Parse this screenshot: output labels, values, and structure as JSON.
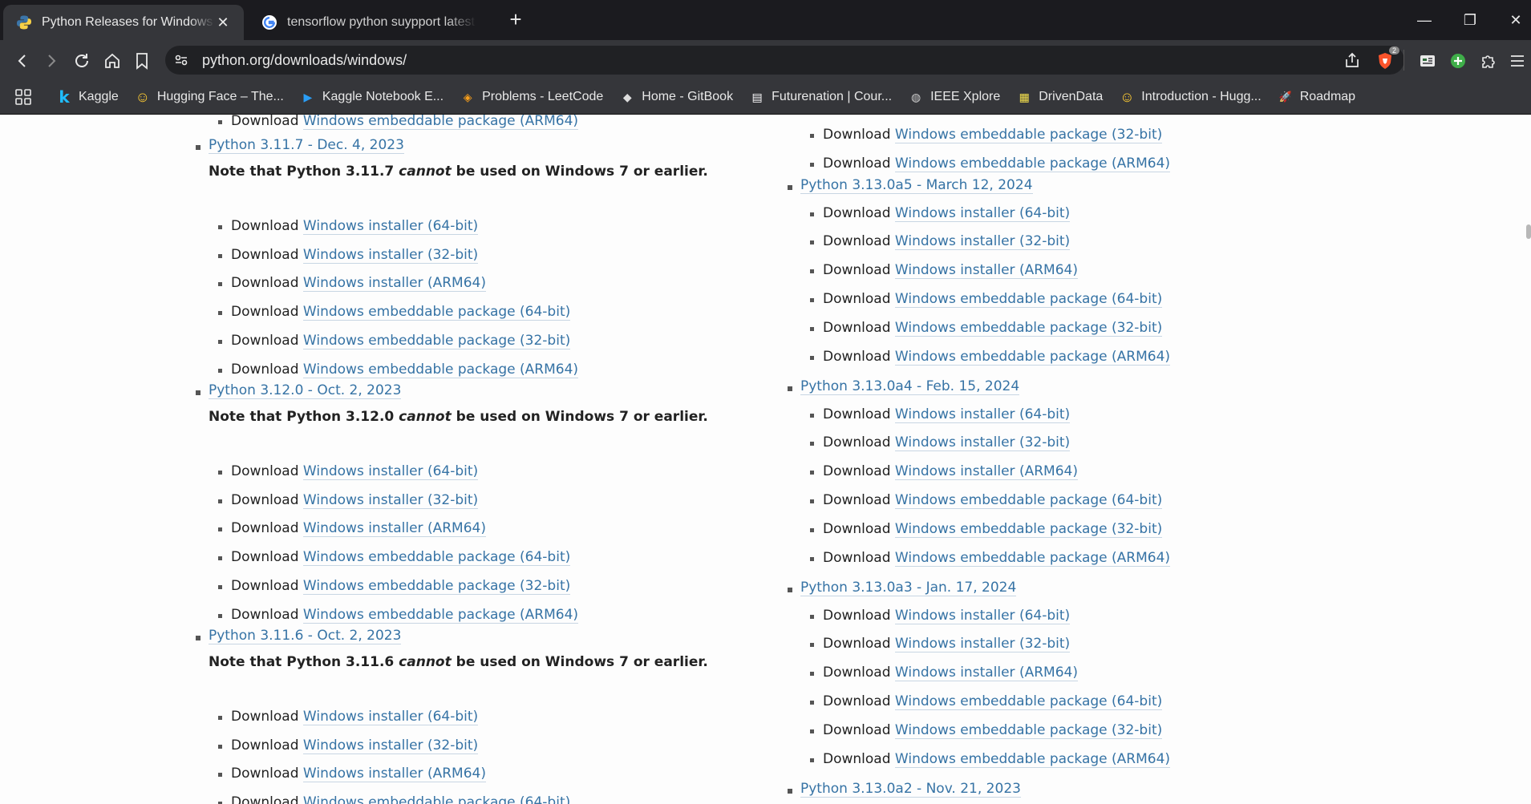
{
  "tabs": [
    {
      "title": "Python Releases for Windows | Python.org",
      "active": true,
      "close_label": "✕"
    },
    {
      "title": "tensorflow python suypport latest - Google Search",
      "active": false
    }
  ],
  "window": {
    "new_tab": "+",
    "minimize": "—",
    "restore": "❐",
    "close": "✕"
  },
  "address": {
    "url": "python.org/downloads/windows/"
  },
  "extensions": {
    "brave_badge": "2"
  },
  "bookmarks": [
    {
      "label": "Kaggle",
      "icon": "kaggle-icon",
      "glyph": "k",
      "color": "#20beff"
    },
    {
      "label": "Hugging Face – The...",
      "icon": "hugging-face-icon",
      "glyph": "☺",
      "color": "#ffcc33"
    },
    {
      "label": "Kaggle Notebook E...",
      "icon": "play-icon",
      "glyph": "▶",
      "color": "#2a9df4"
    },
    {
      "label": "Problems - LeetCode",
      "icon": "leetcode-icon",
      "glyph": "◈",
      "color": "#f89f1b"
    },
    {
      "label": "Home - GitBook",
      "icon": "gitbook-icon",
      "glyph": "◆",
      "color": "#dddddd"
    },
    {
      "label": "Futurenation | Cour...",
      "icon": "futurenation-icon",
      "glyph": "▤",
      "color": "#ffffff"
    },
    {
      "label": "IEEE Xplore",
      "icon": "globe-icon",
      "glyph": "◍",
      "color": "#cccccc"
    },
    {
      "label": "DrivenData",
      "icon": "drivendata-icon",
      "glyph": "▦",
      "color": "#f4e04d"
    },
    {
      "label": "Introduction - Hugg...",
      "icon": "hugging-face-icon",
      "glyph": "☺",
      "color": "#ffcc33"
    },
    {
      "label": "Roadmap",
      "icon": "rocket-icon",
      "glyph": "🚀",
      "color": "#ffffff"
    }
  ],
  "page": {
    "download_word": "Download",
    "left_column": {
      "top_item": "Windows embeddable package (ARM64)",
      "releases": [
        {
          "title": "Python 3.11.7 - Dec. 4, 2023",
          "note_pre": "Note that Python 3.11.7 ",
          "note_em": "cannot",
          "note_post": " be used on Windows 7 or earlier.",
          "items": [
            "Windows installer (64-bit)",
            "Windows installer (32-bit)",
            "Windows installer (ARM64)",
            "Windows embeddable package (64-bit)",
            "Windows embeddable package (32-bit)",
            "Windows embeddable package (ARM64)"
          ]
        },
        {
          "title": "Python 3.12.0 - Oct. 2, 2023",
          "note_pre": "Note that Python 3.12.0 ",
          "note_em": "cannot",
          "note_post": " be used on Windows 7 or earlier.",
          "items": [
            "Windows installer (64-bit)",
            "Windows installer (32-bit)",
            "Windows installer (ARM64)",
            "Windows embeddable package (64-bit)",
            "Windows embeddable package (32-bit)",
            "Windows embeddable package (ARM64)"
          ]
        },
        {
          "title": "Python 3.11.6 - Oct. 2, 2023",
          "note_pre": "Note that Python 3.11.6 ",
          "note_em": "cannot",
          "note_post": " be used on Windows 7 or earlier.",
          "items": [
            "Windows installer (64-bit)",
            "Windows installer (32-bit)",
            "Windows installer (ARM64)",
            "Windows embeddable package (64-bit)"
          ]
        }
      ]
    },
    "right_column": {
      "top_items": [
        "Windows embeddable package (32-bit)",
        "Windows embeddable package (ARM64)"
      ],
      "releases": [
        {
          "title": "Python 3.13.0a5 - March 12, 2024",
          "items": [
            "Windows installer (64-bit)",
            "Windows installer (32-bit)",
            "Windows installer (ARM64)",
            "Windows embeddable package (64-bit)",
            "Windows embeddable package (32-bit)",
            "Windows embeddable package (ARM64)"
          ]
        },
        {
          "title": "Python 3.13.0a4 - Feb. 15, 2024",
          "items": [
            "Windows installer (64-bit)",
            "Windows installer (32-bit)",
            "Windows installer (ARM64)",
            "Windows embeddable package (64-bit)",
            "Windows embeddable package (32-bit)",
            "Windows embeddable package (ARM64)"
          ]
        },
        {
          "title": "Python 3.13.0a3 - Jan. 17, 2024",
          "items": [
            "Windows installer (64-bit)",
            "Windows installer (32-bit)",
            "Windows installer (ARM64)",
            "Windows embeddable package (64-bit)",
            "Windows embeddable package (32-bit)",
            "Windows embeddable package (ARM64)"
          ]
        },
        {
          "title": "Python 3.13.0a2 - Nov. 21, 2023",
          "items": []
        }
      ]
    }
  }
}
